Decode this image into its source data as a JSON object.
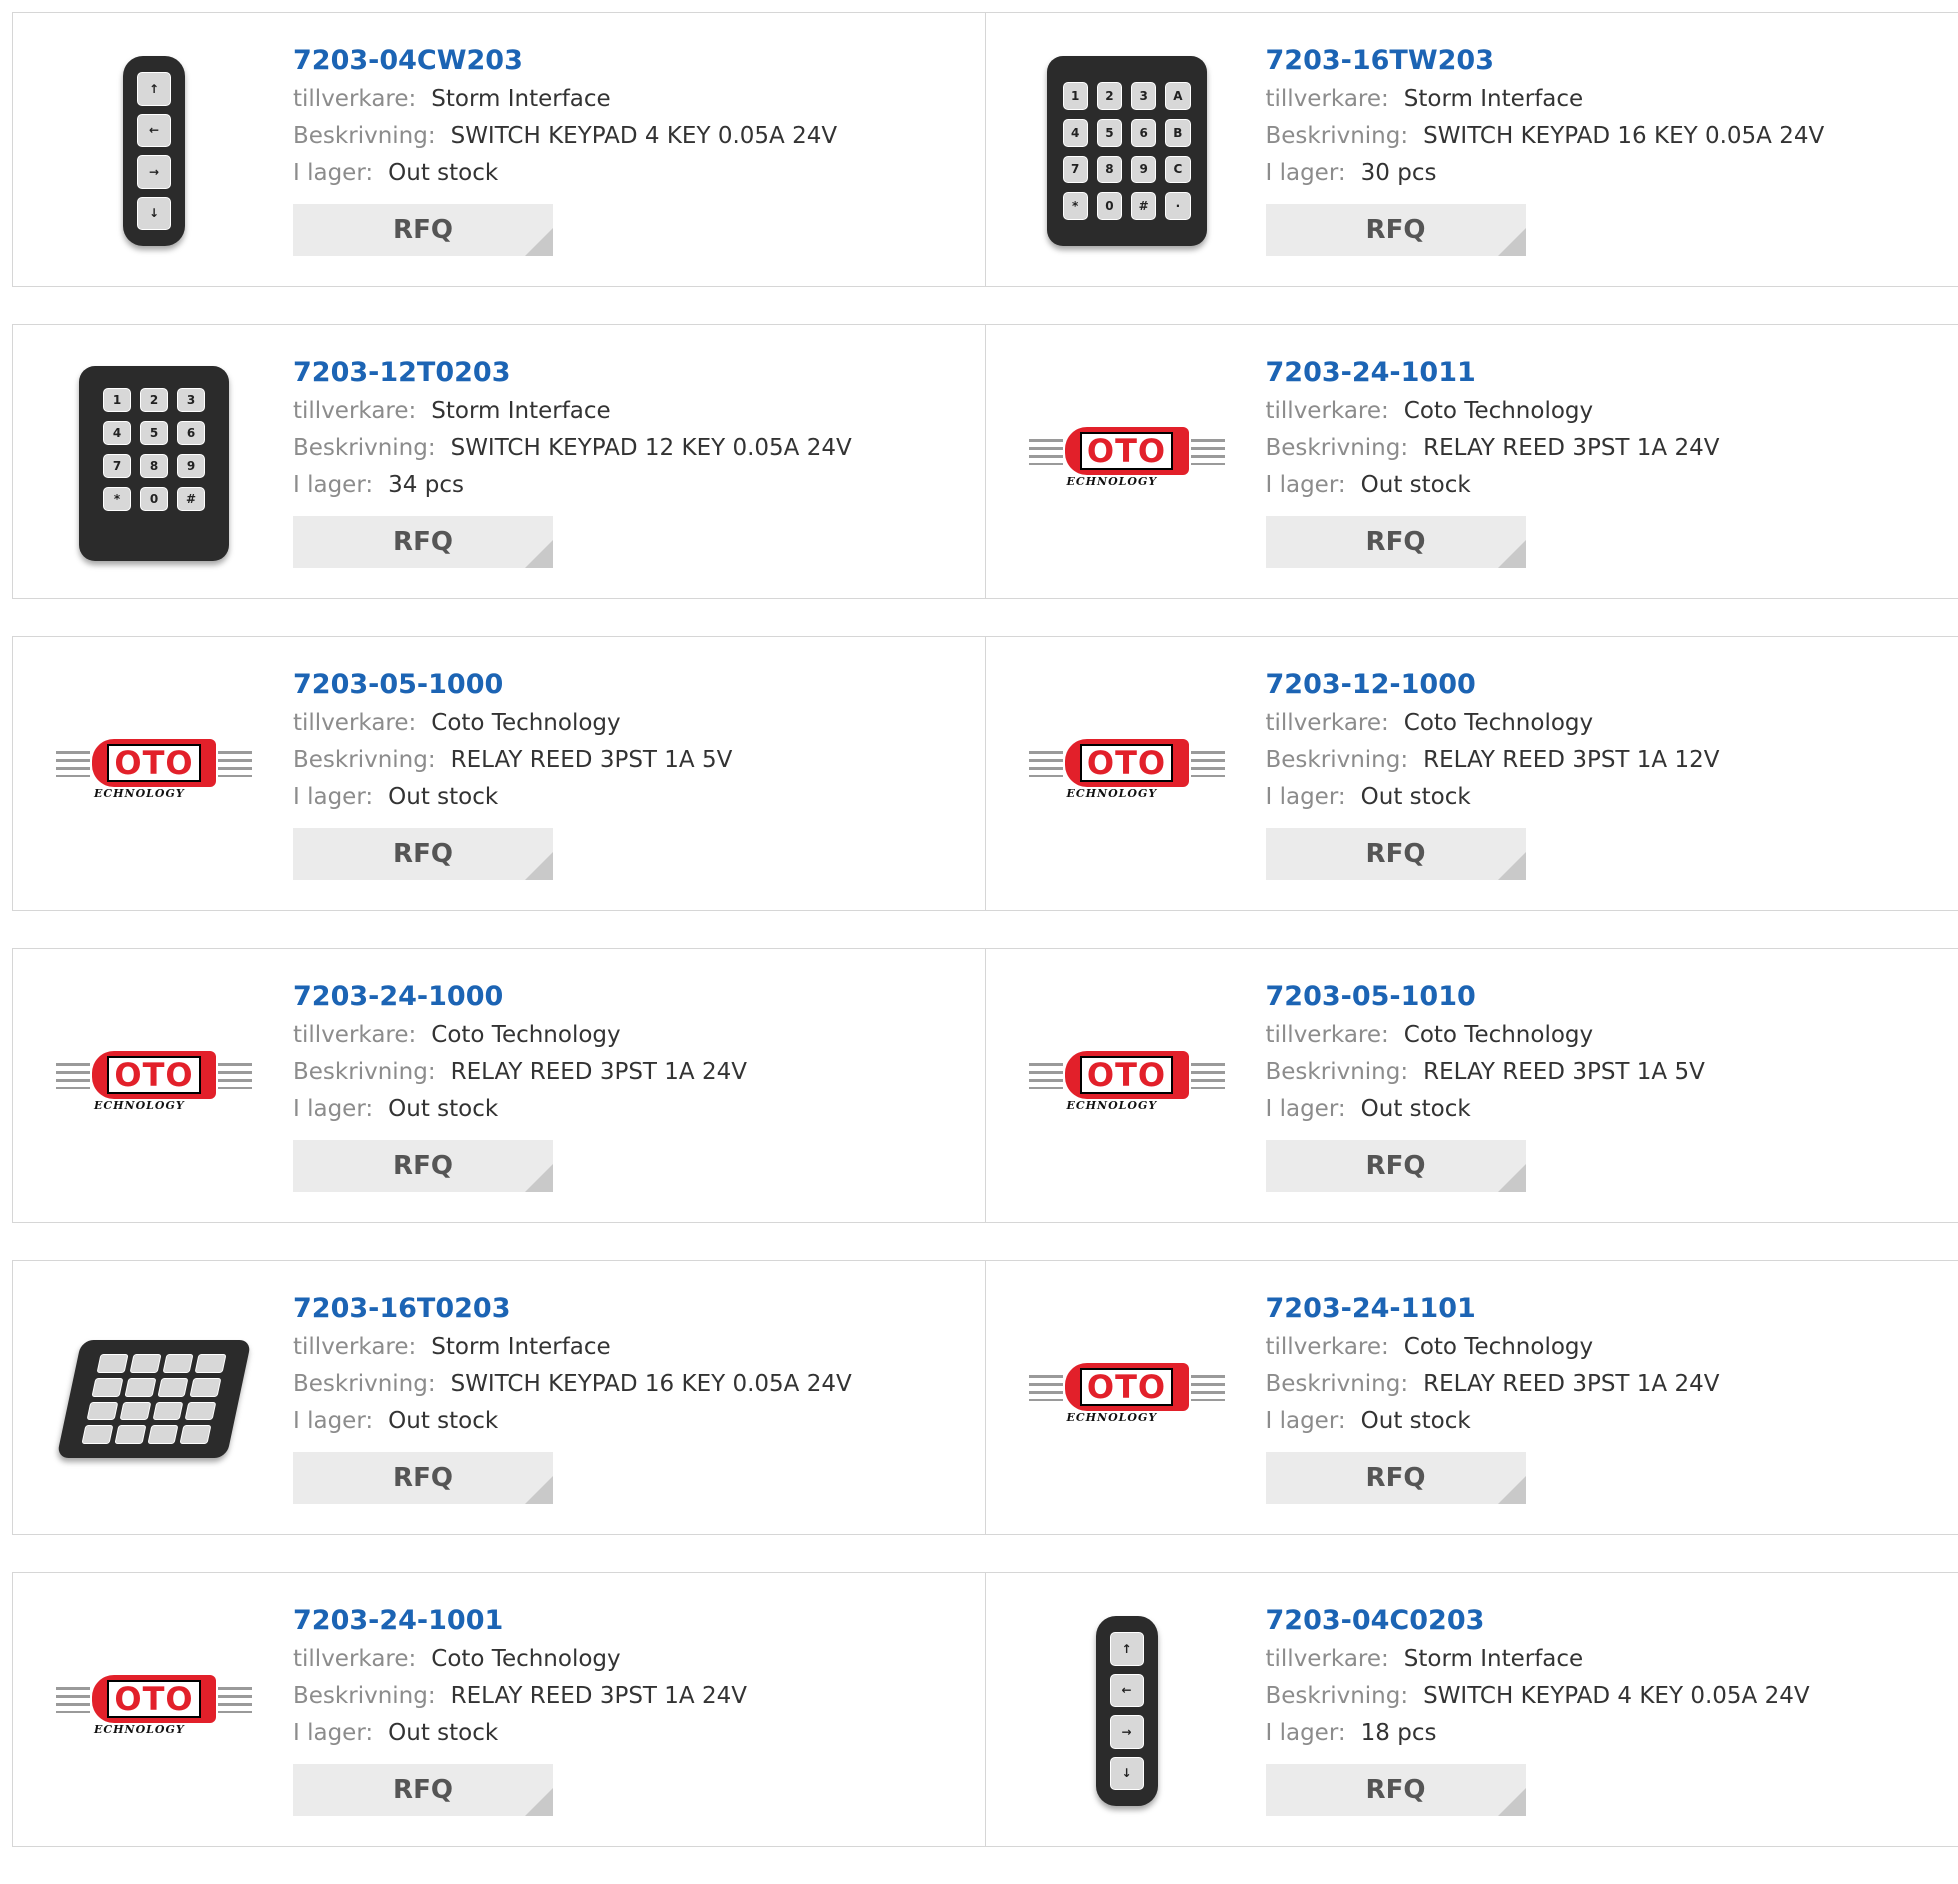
{
  "labels": {
    "manufacturer": "tillverkare:",
    "description": "Beskrivning:",
    "stock": "I lager:",
    "rfq": "RFQ"
  },
  "coto_logo": {
    "word": "OTO",
    "tagline": "ECHNOLOGY"
  },
  "products": [
    {
      "part": "7203-04CW203",
      "manufacturer": "Storm Interface",
      "description": "SWITCH KEYPAD 4 KEY 0.05A 24V",
      "stock": "Out stock",
      "image": "keypad-4",
      "keys": [
        "↑",
        "←",
        "→",
        "↓"
      ]
    },
    {
      "part": "7203-16TW203",
      "manufacturer": "Storm Interface",
      "description": "SWITCH KEYPAD 16 KEY 0.05A 24V",
      "stock": "30 pcs",
      "image": "keypad-16",
      "keys": [
        "1",
        "2",
        "3",
        "A",
        "4",
        "5",
        "6",
        "B",
        "7",
        "8",
        "9",
        "C",
        "*",
        "0",
        "#",
        "·"
      ]
    },
    {
      "part": "7203-12T0203",
      "manufacturer": "Storm Interface",
      "description": "SWITCH KEYPAD 12 KEY 0.05A 24V",
      "stock": "34 pcs",
      "image": "keypad-12",
      "keys": [
        "1",
        "2",
        "3",
        "4",
        "5",
        "6",
        "7",
        "8",
        "9",
        "*",
        "0",
        "#"
      ]
    },
    {
      "part": "7203-24-1011",
      "manufacturer": "Coto Technology",
      "description": "RELAY REED 3PST 1A 24V",
      "stock": "Out stock",
      "image": "coto-logo"
    },
    {
      "part": "7203-05-1000",
      "manufacturer": "Coto Technology",
      "description": "RELAY REED 3PST 1A 5V",
      "stock": "Out stock",
      "image": "coto-logo"
    },
    {
      "part": "7203-12-1000",
      "manufacturer": "Coto Technology",
      "description": "RELAY REED 3PST 1A 12V",
      "stock": "Out stock",
      "image": "coto-logo"
    },
    {
      "part": "7203-24-1000",
      "manufacturer": "Coto Technology",
      "description": "RELAY REED 3PST 1A 24V",
      "stock": "Out stock",
      "image": "coto-logo"
    },
    {
      "part": "7203-05-1010",
      "manufacturer": "Coto Technology",
      "description": "RELAY REED 3PST 1A 5V",
      "stock": "Out stock",
      "image": "coto-logo"
    },
    {
      "part": "7203-16T0203",
      "manufacturer": "Storm Interface",
      "description": "SWITCH KEYPAD 16 KEY 0.05A 24V",
      "stock": "Out stock",
      "image": "keypad-16-flat",
      "keys": [
        "",
        "",
        "",
        "",
        "",
        "",
        "",
        "",
        "",
        "",
        "",
        "",
        "",
        "",
        "",
        ""
      ]
    },
    {
      "part": "7203-24-1101",
      "manufacturer": "Coto Technology",
      "description": "RELAY REED 3PST 1A 24V",
      "stock": "Out stock",
      "image": "coto-logo"
    },
    {
      "part": "7203-24-1001",
      "manufacturer": "Coto Technology",
      "description": "RELAY REED 3PST 1A 24V",
      "stock": "Out stock",
      "image": "coto-logo"
    },
    {
      "part": "7203-04C0203",
      "manufacturer": "Storm Interface",
      "description": "SWITCH KEYPAD 4 KEY 0.05A 24V",
      "stock": "18 pcs",
      "image": "keypad-4",
      "keys": [
        "↑",
        "←",
        "→",
        "↓"
      ]
    }
  ],
  "colors": {
    "link": "#1c64b4",
    "label": "#8c8c8c",
    "button_bg": "#ebebeb",
    "border": "#d6d6d6",
    "coto_red": "#e2202a"
  }
}
